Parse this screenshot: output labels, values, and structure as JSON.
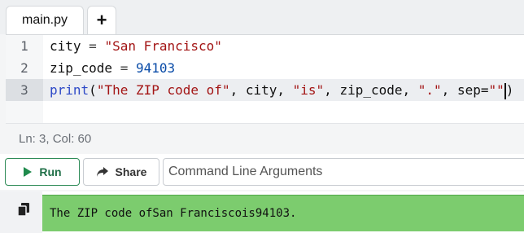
{
  "tabs": {
    "active": "main.py",
    "add_label": "+"
  },
  "editor": {
    "lines": [
      {
        "number": "1",
        "tokens": [
          {
            "t": "city",
            "k": "id"
          },
          {
            "t": " = ",
            "k": "op"
          },
          {
            "t": "\"San Francisco\"",
            "k": "str"
          }
        ]
      },
      {
        "number": "2",
        "tokens": [
          {
            "t": "zip_code",
            "k": "id"
          },
          {
            "t": " = ",
            "k": "op"
          },
          {
            "t": "94103",
            "k": "num"
          }
        ]
      },
      {
        "number": "3",
        "tokens": [
          {
            "t": "print",
            "k": "kw"
          },
          {
            "t": "(",
            "k": "id"
          },
          {
            "t": "\"The ZIP code of\"",
            "k": "str"
          },
          {
            "t": ", city, ",
            "k": "id"
          },
          {
            "t": "\"is\"",
            "k": "str"
          },
          {
            "t": ", zip_code, ",
            "k": "id"
          },
          {
            "t": "\".\"",
            "k": "str"
          },
          {
            "t": ", sep=",
            "k": "id"
          },
          {
            "t": "\"\"",
            "k": "str"
          },
          {
            "t": ")",
            "k": "id"
          }
        ]
      }
    ],
    "active_line": "3"
  },
  "status": {
    "text": "Ln: 3,  Col: 60"
  },
  "toolbar": {
    "run_label": "Run",
    "share_label": "Share",
    "args_placeholder": "Command Line Arguments"
  },
  "console": {
    "output": "The ZIP code ofSan Franciscois94103.",
    "copy_icon": "copy-icon"
  },
  "colors": {
    "run_accent": "#1f8a4c",
    "output_bg": "#7ccc6e",
    "string": "#a31515",
    "number": "#0a4ca8",
    "keyword": "#2d49c7"
  }
}
